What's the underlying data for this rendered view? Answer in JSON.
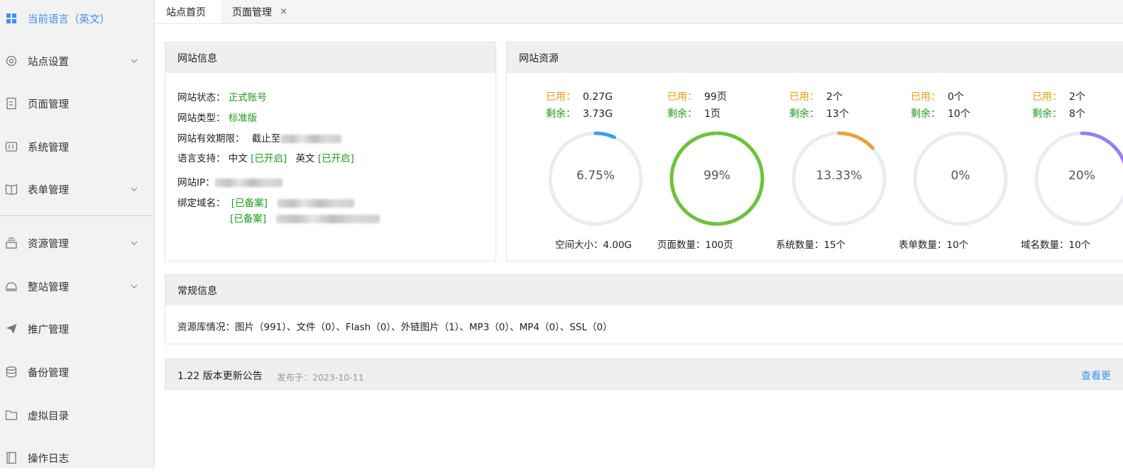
{
  "sidebar": {
    "items": [
      {
        "label": "当前语言（英文）",
        "icon": "grid-icon",
        "active": true
      },
      {
        "label": "站点设置",
        "icon": "gear-icon",
        "chevron": true
      },
      {
        "label": "页面管理",
        "icon": "document-icon"
      },
      {
        "label": "系统管理",
        "icon": "system-icon"
      },
      {
        "label": "表单管理",
        "icon": "book-icon",
        "chevron": true
      },
      {
        "label": "资源管理",
        "icon": "stack-icon",
        "chevron": true
      },
      {
        "label": "整站管理",
        "icon": "bell-icon",
        "chevron": true
      },
      {
        "label": "推广管理",
        "icon": "paper-plane-icon"
      },
      {
        "label": "备份管理",
        "icon": "database-icon"
      },
      {
        "label": "虚拟目录",
        "icon": "folder-icon"
      },
      {
        "label": "操作日志",
        "icon": "notebook-icon"
      }
    ]
  },
  "tabs": [
    {
      "label": "站点首页"
    },
    {
      "label": "页面管理",
      "close": "×"
    }
  ],
  "site_info": {
    "title": "网站信息",
    "status_label": "网站状态：",
    "status_value": "正式账号",
    "type_label": "网站类型：",
    "type_value": "标准版",
    "expiry_label": "网站有效期限：",
    "expiry_prefix": "截止至",
    "lang_label": "语言支持：",
    "lang_zh": "中文",
    "lang_zh_state": "[已开启]",
    "lang_en": "英文",
    "lang_en_state": "[已开启]",
    "ip_label": "网站IP：",
    "domain_label": "绑定域名：",
    "domain_state_1": "[已备案]",
    "domain_state_2": "[已备案]"
  },
  "resources": {
    "title": "网站资源",
    "used_key": "已用：",
    "left_key": "剩余：",
    "items": [
      {
        "used": "0.27G",
        "left": "3.73G",
        "percent_text": "6.75%",
        "fraction": 0.0675,
        "color": "#3e9cf2",
        "total": "空间大小：4.00G"
      },
      {
        "used": "99页",
        "left": "1页",
        "percent_text": "99%",
        "fraction": 0.99,
        "color": "#6cc33b",
        "total": "页面数量：100页"
      },
      {
        "used": "2个",
        "left": "13个",
        "percent_text": "13.33%",
        "fraction": 0.1333,
        "color": "#e8a23c",
        "total": "系统数量：15个"
      },
      {
        "used": "0个",
        "left": "10个",
        "percent_text": "0%",
        "fraction": 0,
        "color": "#3e9cf2",
        "total": "表单数量：10个"
      },
      {
        "used": "2个",
        "left": "8个",
        "percent_text": "20%",
        "fraction": 0.2,
        "color": "#9b7bf5",
        "total": "域名数量：10个"
      }
    ]
  },
  "general": {
    "title": "常规信息",
    "text": "资源库情况：图片（991）、文件（0）、Flash（0）、外链图片（1）、MP3（0）、MP4（0）、SSL（0）"
  },
  "notice": {
    "title": "1.22 版本更新公告",
    "date": "发布于：2023-10-11",
    "more": "查看更"
  }
}
